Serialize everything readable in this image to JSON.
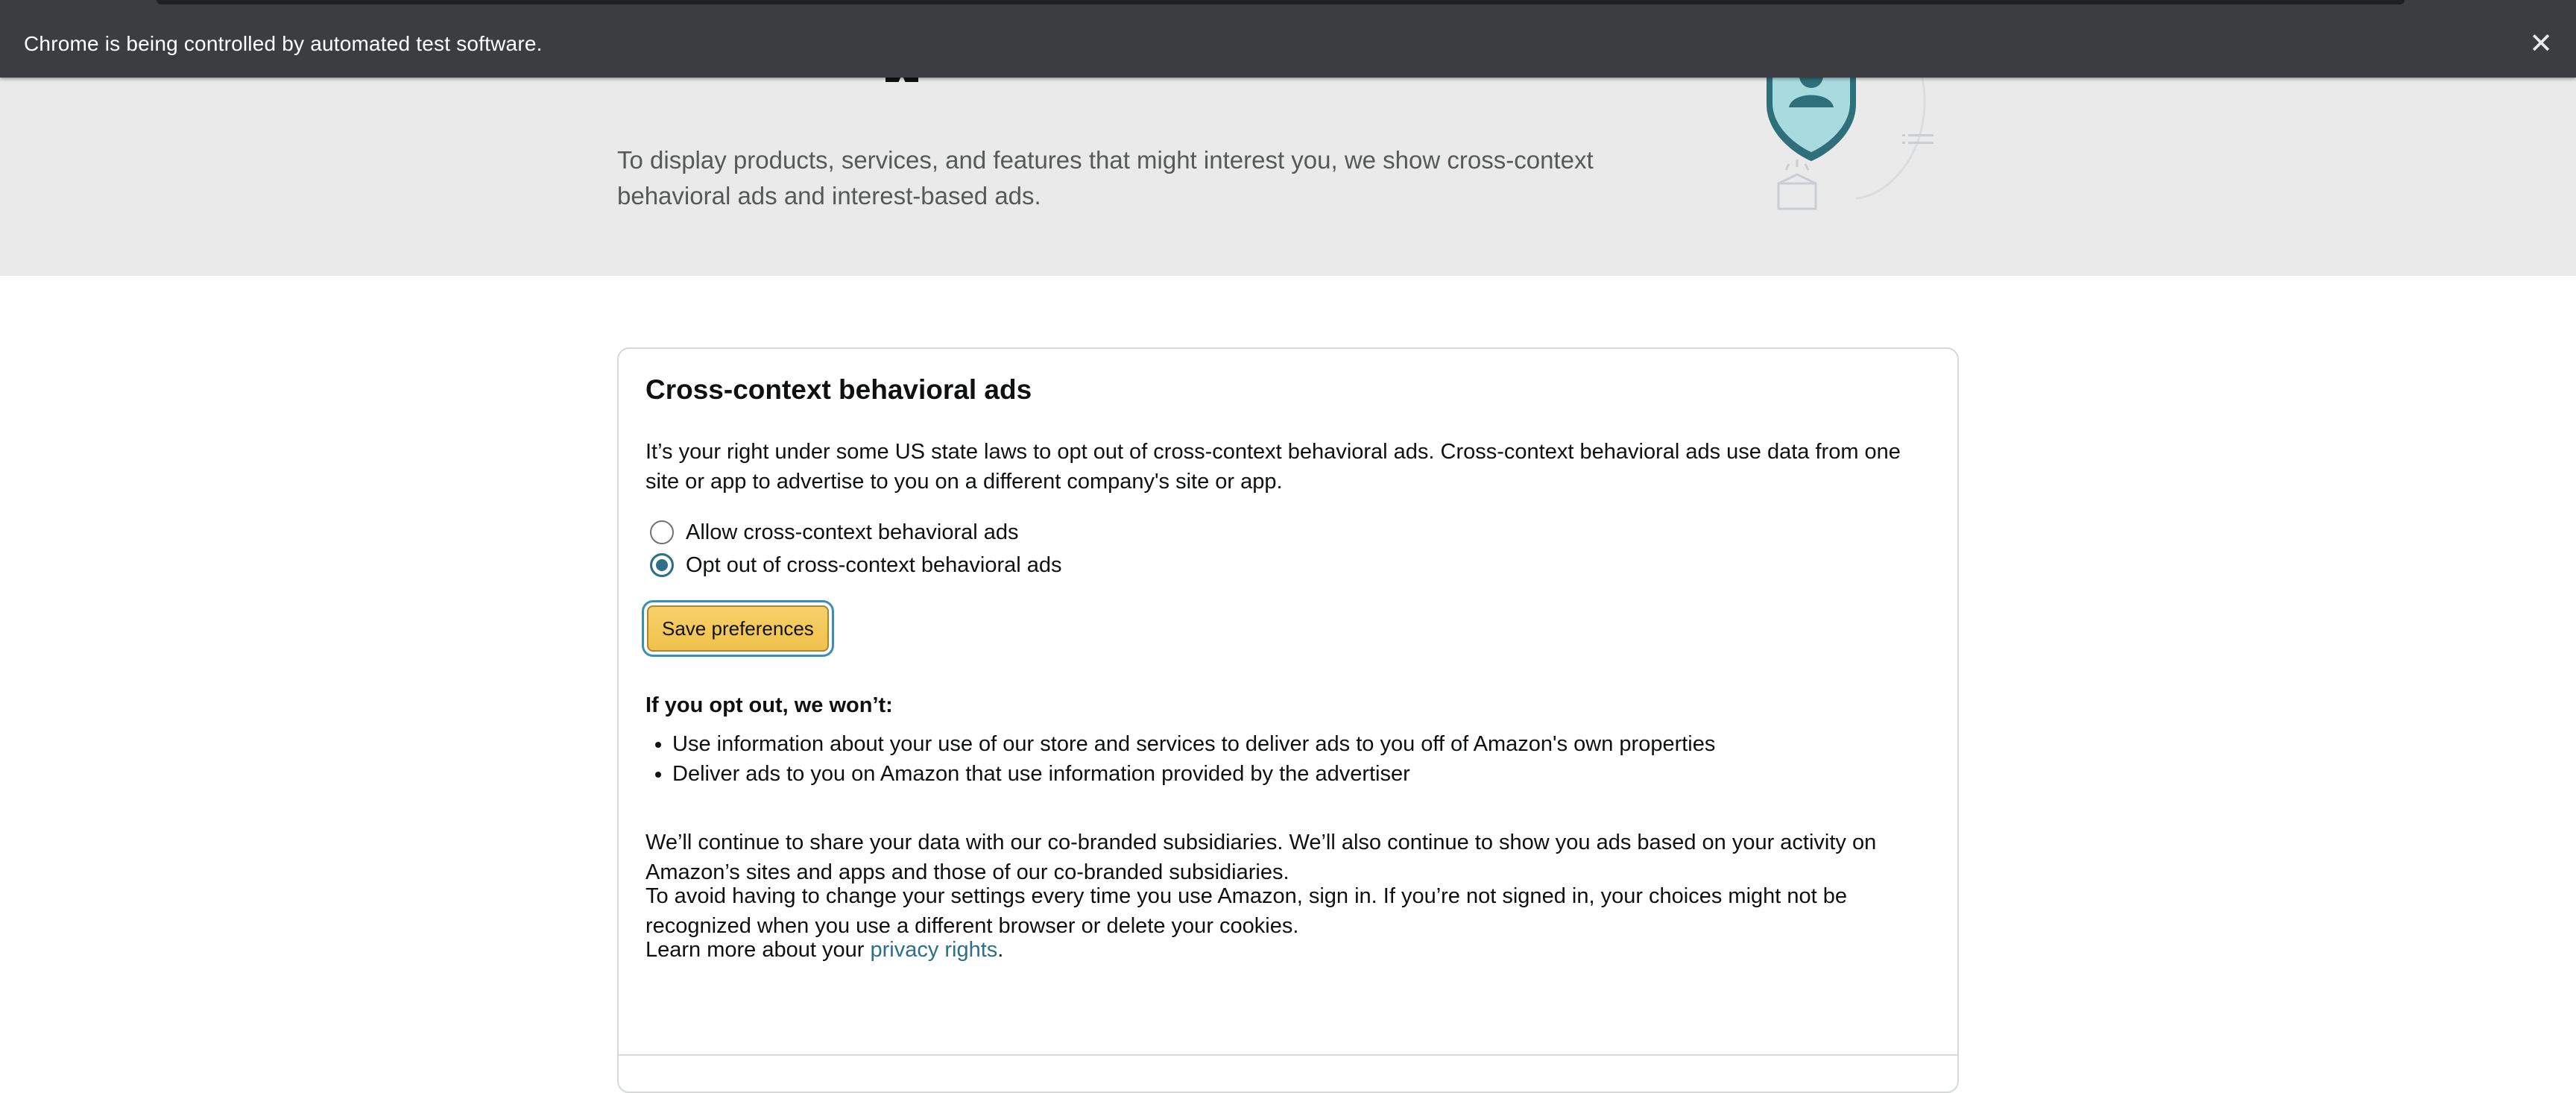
{
  "browser": {
    "automation_message": "Chrome is being controlled by automated test software.",
    "close_glyph": "✕"
  },
  "hero": {
    "intro": "To display products, services, and features that might interest you, we show cross-context behavioral ads and interest-based ads.",
    "illustration": "shield-person-icon"
  },
  "card": {
    "title": "Cross-context behavioral ads",
    "description": "It’s your right under some US state laws to opt out of cross-context behavioral ads. Cross-context behavioral ads use data from one site or app to advertise to you on a different company's site or app.",
    "options": [
      {
        "label": "Allow cross-context behavioral ads",
        "selected": false
      },
      {
        "label": "Opt out of cross-context behavioral ads",
        "selected": true
      }
    ],
    "save_label": "Save preferences",
    "opt_out_heading": "If you opt out, we won’t:",
    "bullets": [
      "Use information about your use of our store and services to deliver ads to you off of Amazon's own properties",
      "Deliver ads to you on Amazon that use information provided by the advertiser"
    ],
    "continue_text": "We’ll continue to share your data with our co-branded subsidiaries. We’ll also continue to show you ads based on your activity on Amazon’s sites and apps and those of our co-branded subsidiaries.",
    "signin_text": "To avoid having to change your settings every time you use Amazon, sign in. If you’re not signed in, your choices might not be recognized when you use a different browser or delete your cookies.",
    "learn_prefix": "Learn more about your ",
    "learn_link": "privacy rights",
    "learn_suffix": "."
  },
  "colors": {
    "accent": "#2f6f89",
    "button": "#f0c14b",
    "hero_bg": "#eaeaea",
    "banner_bg": "#3b3d40"
  }
}
